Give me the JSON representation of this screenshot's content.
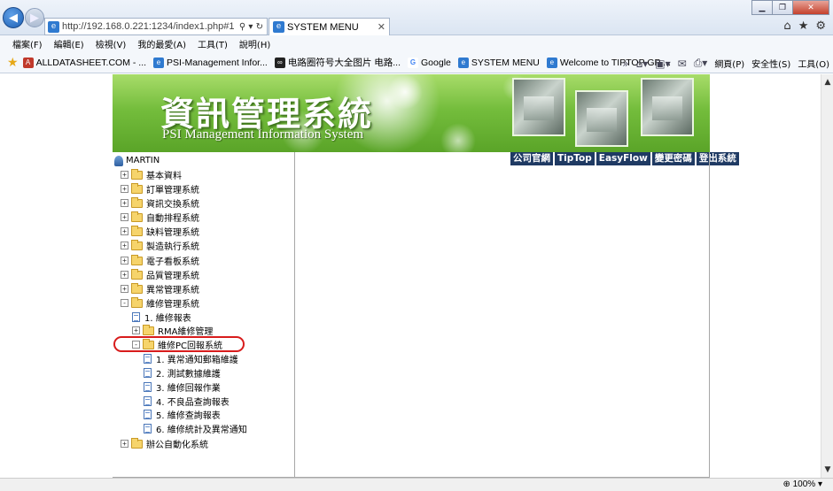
{
  "browser": {
    "address_url": "http://192.168.0.221:1234/index1.php#1",
    "tab_title": "SYSTEM MENU",
    "menu": [
      "檔案(F)",
      "編輯(E)",
      "檢視(V)",
      "我的最愛(A)",
      "工具(T)",
      "說明(H)"
    ],
    "favorites": [
      {
        "label": "ALLDATASHEET.COM - ...",
        "icon": "alldatasheet-icon",
        "color": "#c0392b"
      },
      {
        "label": "PSI-Management Infor...",
        "icon": "ie-page-icon",
        "color": "#2f7ad0"
      },
      {
        "label": "电路圈符号大全图片 电路...",
        "icon": "infinity-icon",
        "color": "#222222"
      },
      {
        "label": "Google",
        "icon": "google-icon",
        "color": "#4285f4"
      },
      {
        "label": "SYSTEM MENU",
        "icon": "ie-page-icon",
        "color": "#2f7ad0"
      },
      {
        "label": "Welcome to TIPTOP GP ...",
        "icon": "ie-page-icon",
        "color": "#2f7ad0"
      }
    ],
    "toolbar_right": {
      "page": "網頁(P)",
      "safety": "安全性(S)",
      "tools": "工具(O)"
    },
    "zoom": "100%"
  },
  "banner": {
    "title_cn": "資訊管理系統",
    "title_en": "PSI Management Information System"
  },
  "top_nav": [
    "公司官網",
    "TipTop",
    "EasyFlow",
    "變更密碼",
    "登出系統"
  ],
  "tree": {
    "user": "MARTIN",
    "items": [
      {
        "label": "基本資料",
        "kind": "folder",
        "state": "+",
        "level": 0
      },
      {
        "label": "訂單管理系統",
        "kind": "folder",
        "state": "+",
        "level": 0
      },
      {
        "label": "資訊交換系統",
        "kind": "folder",
        "state": "+",
        "level": 0
      },
      {
        "label": "自動排程系統",
        "kind": "folder",
        "state": "+",
        "level": 0
      },
      {
        "label": "缺料管理系統",
        "kind": "folder",
        "state": "+",
        "level": 0
      },
      {
        "label": "製造執行系統",
        "kind": "folder",
        "state": "+",
        "level": 0
      },
      {
        "label": "電子看板系統",
        "kind": "folder",
        "state": "+",
        "level": 0
      },
      {
        "label": "品質管理系統",
        "kind": "folder",
        "state": "+",
        "level": 0
      },
      {
        "label": "異常管理系統",
        "kind": "folder",
        "state": "+",
        "level": 0
      },
      {
        "label": "維修管理系統",
        "kind": "folder",
        "state": "-",
        "level": 0
      },
      {
        "label": "1. 維修報表",
        "kind": "doc",
        "level": 1
      },
      {
        "label": "RMA維修管理",
        "kind": "folder",
        "state": "+",
        "level": 1
      },
      {
        "label": "維修PC回報系統",
        "kind": "folder",
        "state": "-",
        "level": 1
      },
      {
        "label": "1. 異常通知郵箱維護",
        "kind": "doc",
        "level": 2
      },
      {
        "label": "2. 測試數據維護",
        "kind": "doc",
        "level": 2
      },
      {
        "label": "3. 維修回報作業",
        "kind": "doc",
        "level": 2
      },
      {
        "label": "4. 不良品查詢報表",
        "kind": "doc",
        "level": 2
      },
      {
        "label": "5. 維修查詢報表",
        "kind": "doc",
        "level": 2
      },
      {
        "label": "6. 維修統計及異常通知",
        "kind": "doc",
        "level": 2
      },
      {
        "label": "辦公自動化系統",
        "kind": "folder",
        "state": "+",
        "level": 0
      }
    ]
  }
}
